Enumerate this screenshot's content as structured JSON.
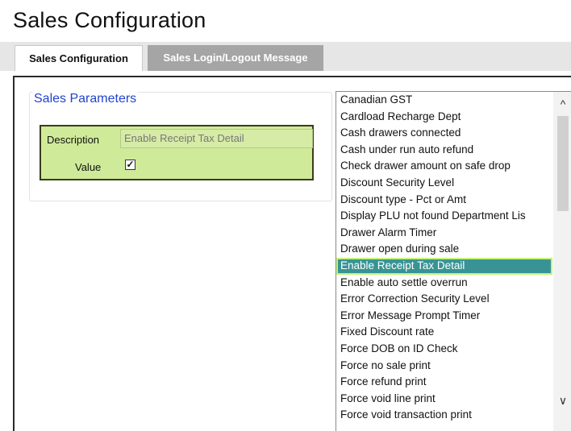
{
  "page": {
    "title": "Sales Configuration"
  },
  "tabs": [
    {
      "label": "Sales Configuration",
      "active": true
    },
    {
      "label": "Sales Login/Logout Message",
      "active": false
    }
  ],
  "parameters": {
    "legend": "Sales Parameters",
    "description_label": "Description",
    "description_value": "Enable Receipt Tax Detail",
    "value_label": "Value",
    "value_checked": true,
    "check_glyph": "✓"
  },
  "list": {
    "selected_index": 10,
    "items": [
      "Canadian GST",
      "Cardload Recharge Dept",
      "Cash drawers connected",
      "Cash under run auto refund",
      "Check drawer amount on safe drop",
      "Discount Security Level",
      "Discount type - Pct or Amt",
      "Display PLU not found Department Lis",
      "Drawer Alarm Timer",
      "Drawer open during sale",
      "Enable Receipt Tax Detail",
      "Enable auto settle overrun",
      "Error Correction Security Level",
      "Error Message Prompt Timer",
      "Fixed Discount rate",
      "Force DOB on ID Check",
      "Force no sale print",
      "Force refund print",
      "Force void line print",
      "Force void transaction print"
    ]
  },
  "scrollbar": {
    "up_icon": "chevron-up-icon",
    "down_icon": "chevron-down-icon",
    "up_glyph": "^",
    "down_glyph": "∨"
  },
  "colors": {
    "accent_blue": "#2244cc",
    "param_box_bg": "#cfeb99",
    "selected_bg": "#389494",
    "selected_border": "#c6f27a",
    "inactive_tab_bg": "#a5a5a5"
  }
}
